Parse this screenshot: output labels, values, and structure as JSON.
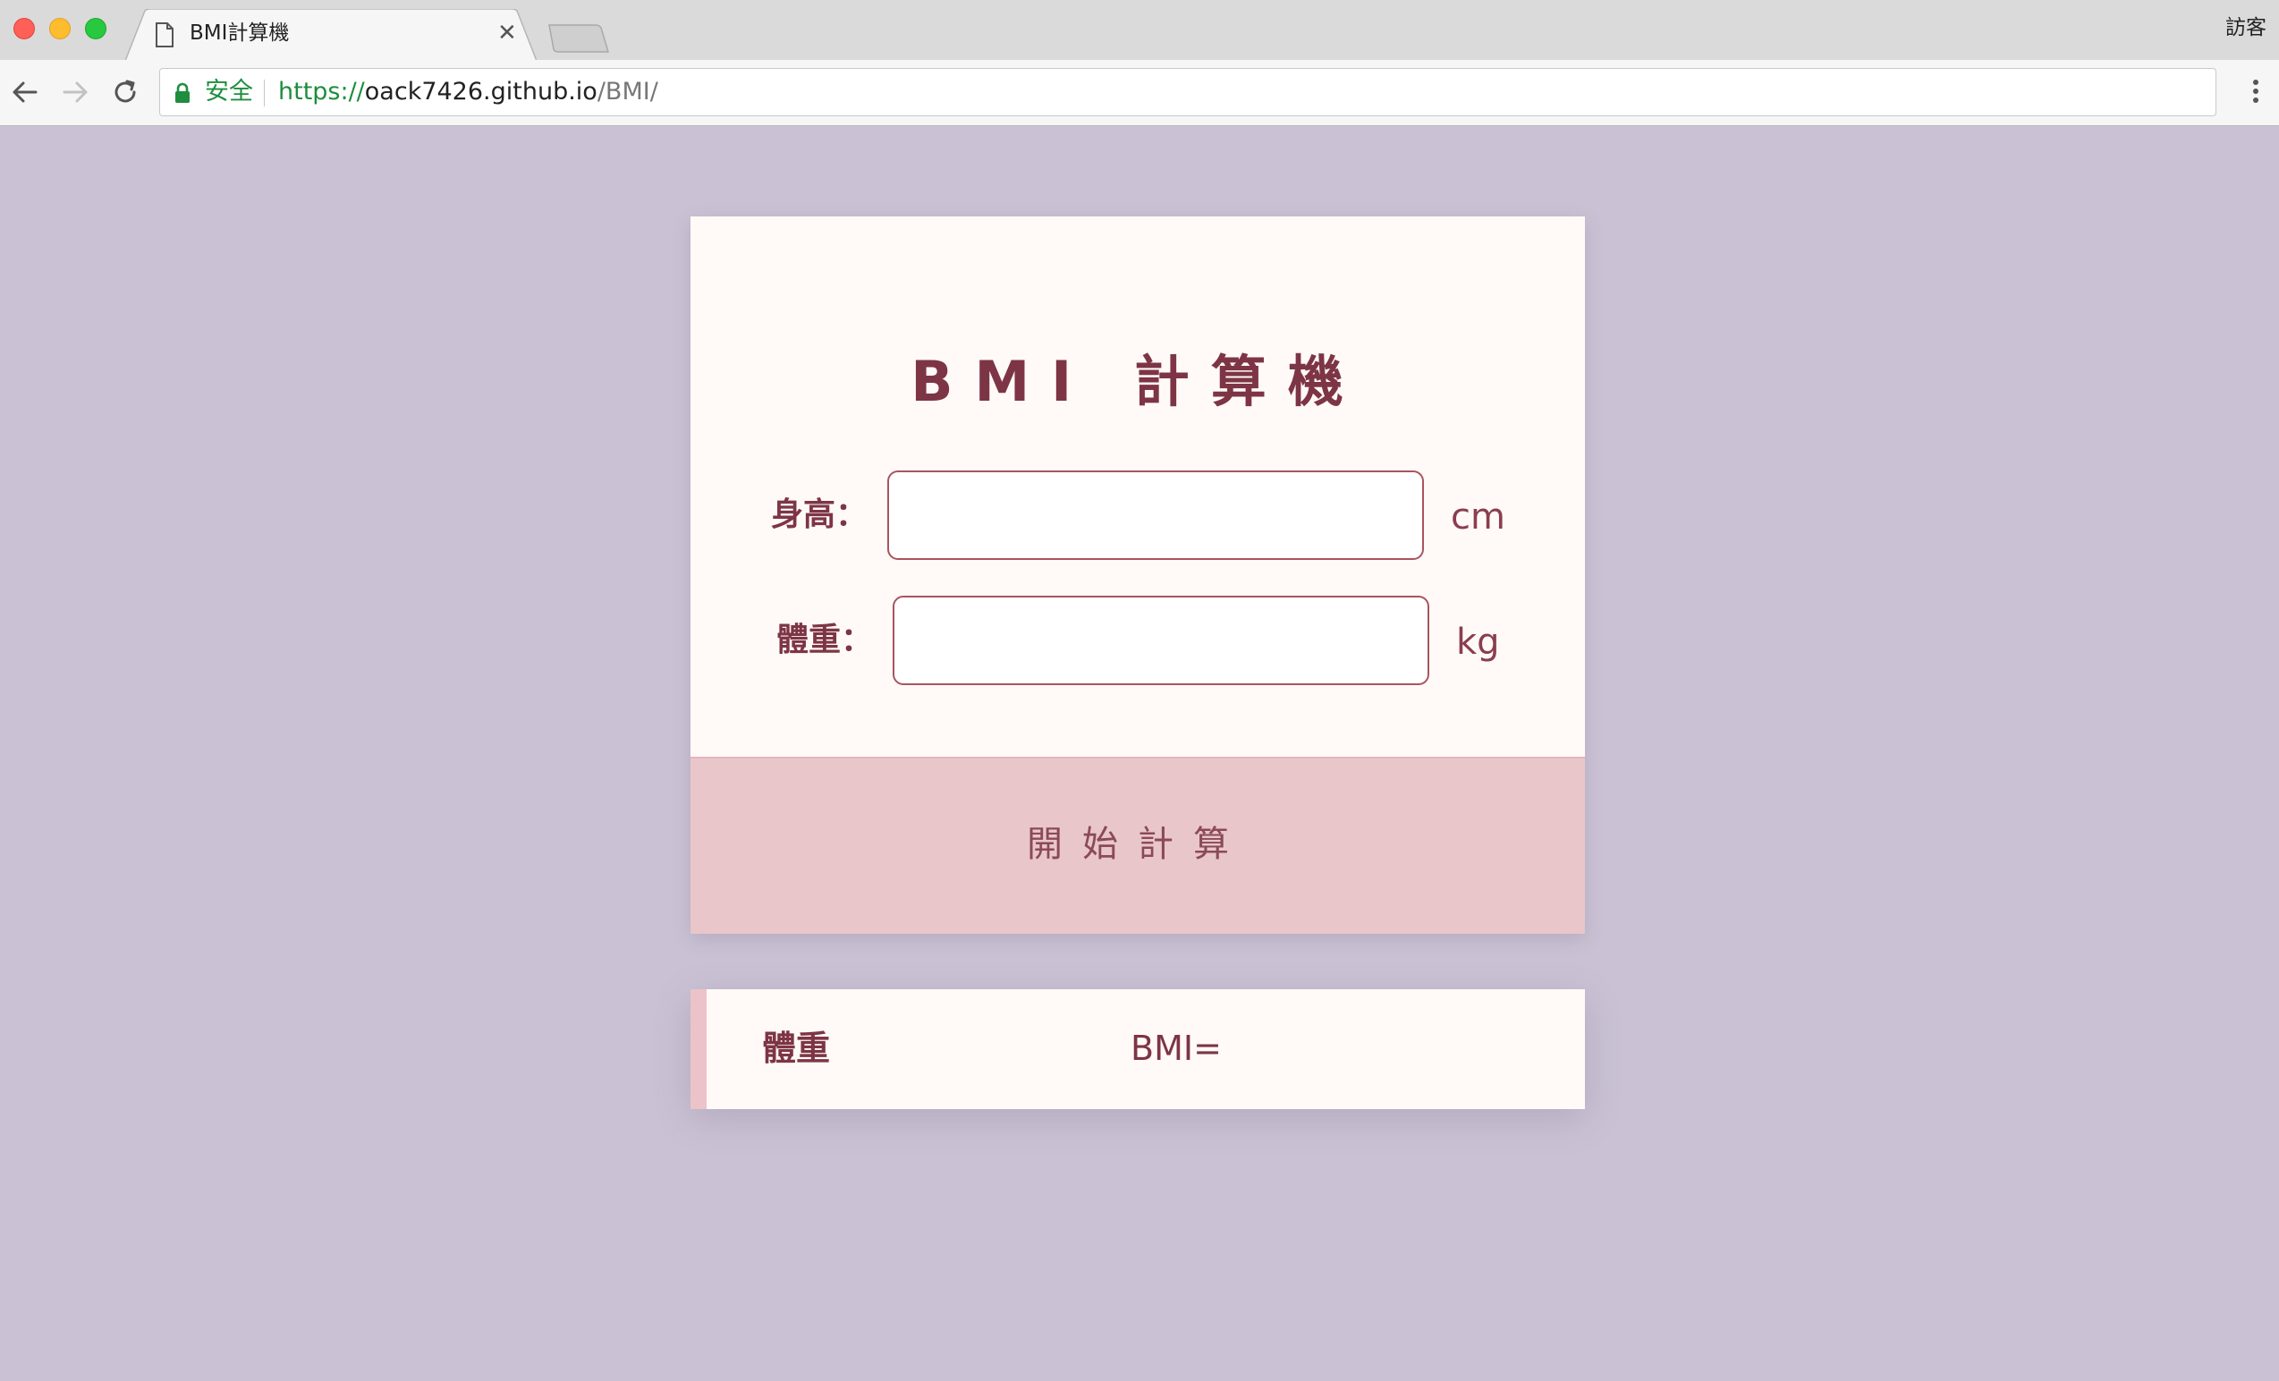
{
  "browser": {
    "tab_title": "BMI計算機",
    "profile_label": "訪客",
    "secure_label": "安全",
    "url_scheme": "https://",
    "url_host": "oack7426.github.io",
    "url_path": "/BMI/"
  },
  "app": {
    "title": "BMI 計算機",
    "height_label": "身高：",
    "height_value": "",
    "height_unit": "cm",
    "weight_label": "體重：",
    "weight_value": "",
    "weight_unit": "kg",
    "calculate_label": "開始計算"
  },
  "result": {
    "status_label": "體重",
    "bmi_label": "BMI="
  },
  "colors": {
    "page_background": "#cac2d4",
    "card_background": "#fffaf7",
    "accent_text": "#7d3545",
    "button_background": "#e9c6ca",
    "input_border": "#a9545f",
    "secure_green": "#1e8e3e"
  },
  "icons": [
    "document-icon",
    "close-icon",
    "back-icon",
    "forward-icon",
    "reload-icon",
    "lock-icon",
    "menu-icon"
  ]
}
